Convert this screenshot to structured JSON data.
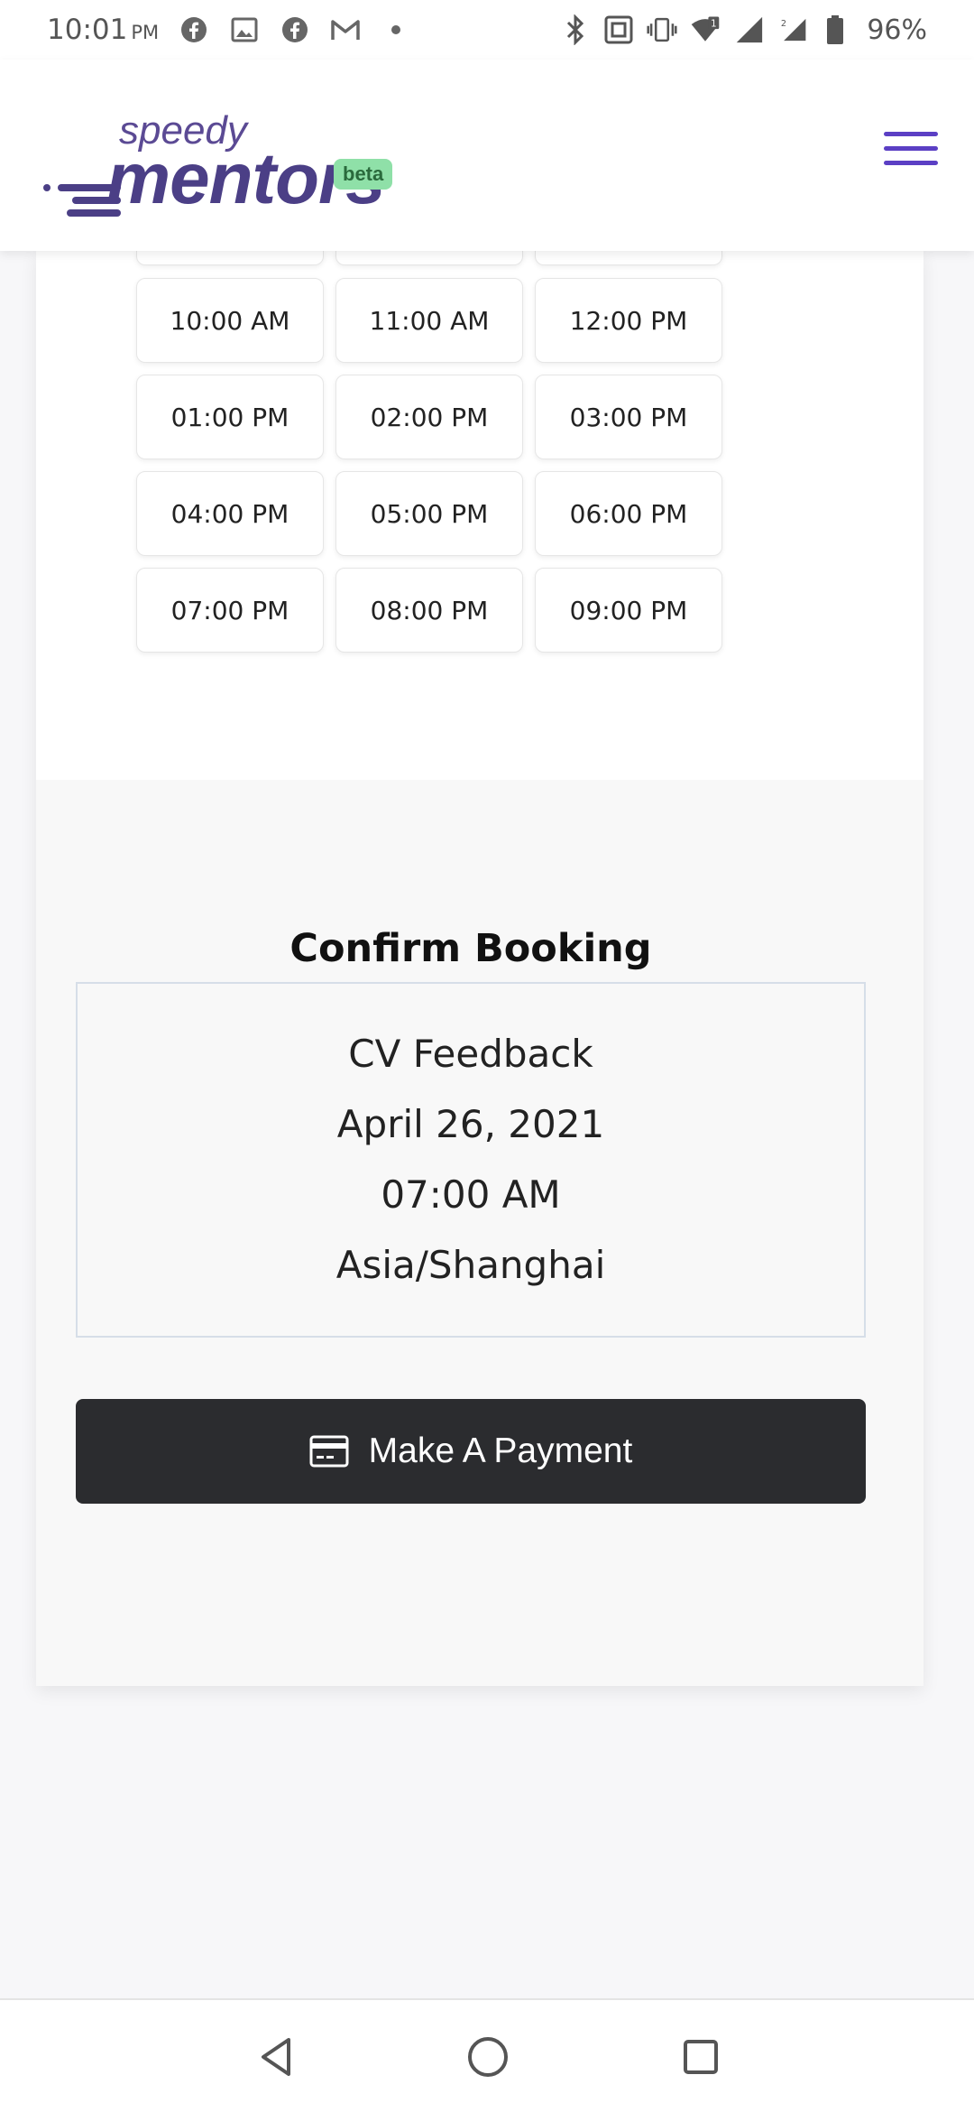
{
  "status_bar": {
    "time": "10:01",
    "ampm": "PM",
    "battery": "96%"
  },
  "header": {
    "logo_top": "speedy",
    "logo_main": "mentors",
    "badge": "beta",
    "brand_color": "#4b3f86",
    "menu_icon": "hamburger-menu-icon"
  },
  "time_slots": [
    "10:00 AM",
    "11:00 AM",
    "12:00 PM",
    "01:00 PM",
    "02:00 PM",
    "03:00 PM",
    "04:00 PM",
    "05:00 PM",
    "06:00 PM",
    "07:00 PM",
    "08:00 PM",
    "09:00 PM"
  ],
  "confirm": {
    "title": "Confirm Booking",
    "service": "CV Feedback",
    "date": "April 26, 2021",
    "time": "07:00 AM",
    "timezone": "Asia/Shanghai",
    "pay_label": "Make A Payment",
    "pay_icon": "credit-card-icon"
  },
  "navigation": {
    "back_icon": "back-triangle-icon",
    "home_icon": "home-circle-icon",
    "recents_icon": "recents-square-icon"
  }
}
